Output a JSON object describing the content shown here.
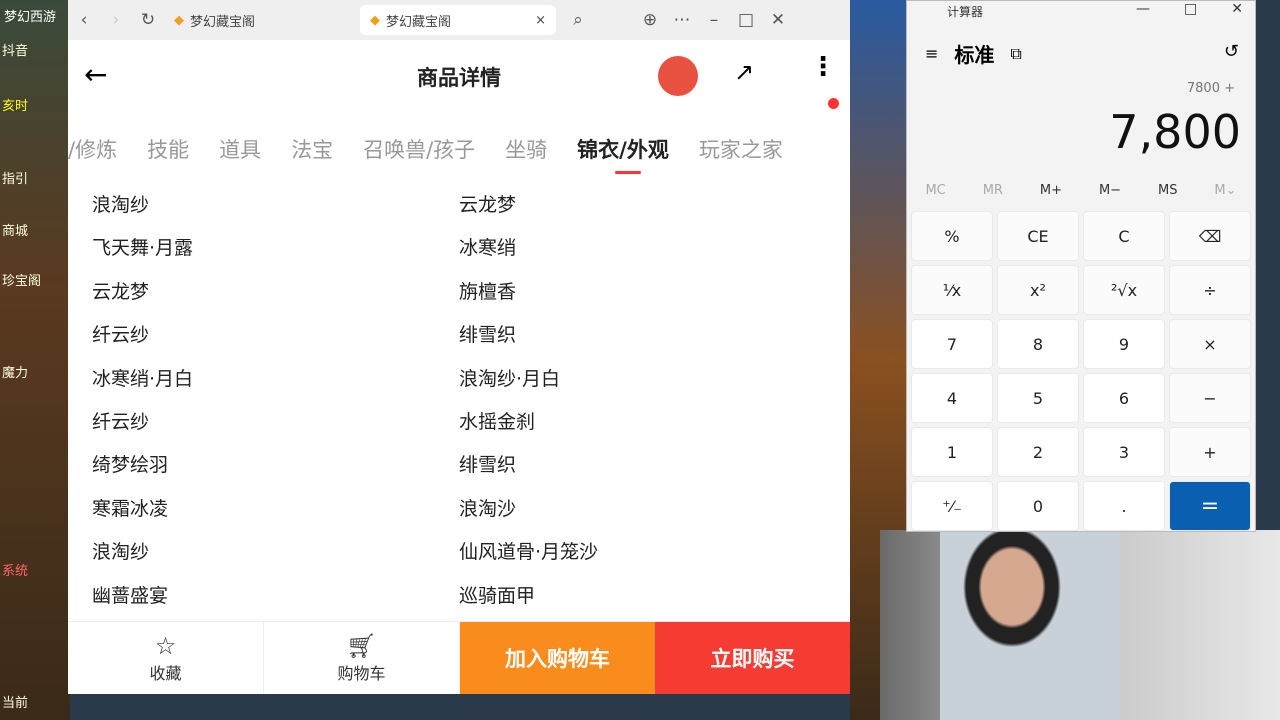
{
  "game": {
    "title": "梦幻西游",
    "tab": "抖音",
    "time_label": "亥时",
    "guide": "指引",
    "shop": "商城",
    "treasure": "珍宝阁",
    "magic": "魔力",
    "system": "系统",
    "current": "当前"
  },
  "browser": {
    "tabs": [
      {
        "label": "梦幻藏宝阁"
      },
      {
        "label": "梦幻藏宝阁",
        "close": "×"
      }
    ]
  },
  "page": {
    "title": "商品详情",
    "categories": [
      "/修炼",
      "技能",
      "道具",
      "法宝",
      "召唤兽/孩子",
      "坐骑",
      "锦衣/外观",
      "玩家之家"
    ],
    "items": [
      "浪淘纱",
      "云龙梦",
      "飞天舞·月露",
      "冰寒绡",
      "云龙梦",
      "旃檀香",
      "纤云纱",
      "绯雪织",
      "冰寒绡·月白",
      "浪淘纱·月白",
      "纤云纱",
      "水摇金刹",
      "绮梦绘羽",
      "绯雪织",
      "寒霜冰凌",
      "浪淘沙",
      "浪淘纱",
      "仙风道骨·月笼沙",
      "幽蔷盛宴",
      "巡骑面甲"
    ],
    "bottom": {
      "favorite": "收藏",
      "cart": "购物车",
      "add_cart": "加入购物车",
      "buy_now": "立即购买"
    }
  },
  "calculator": {
    "title": "计算器",
    "mode": "标准",
    "expression": "7800 +",
    "display": "7,800",
    "memory": [
      "MC",
      "MR",
      "M+",
      "M−",
      "MS",
      "M⌄"
    ],
    "keys": [
      "%",
      "CE",
      "C",
      "⌫",
      "¹⁄x",
      "x²",
      "²√x",
      "÷",
      "7",
      "8",
      "9",
      "×",
      "4",
      "5",
      "6",
      "−",
      "1",
      "2",
      "3",
      "+",
      "⁺⁄₋",
      "0",
      ".",
      "="
    ]
  },
  "colors": {
    "accent": "#f53b32",
    "cart": "#fa8c1e",
    "equals": "#0b5fb0"
  }
}
